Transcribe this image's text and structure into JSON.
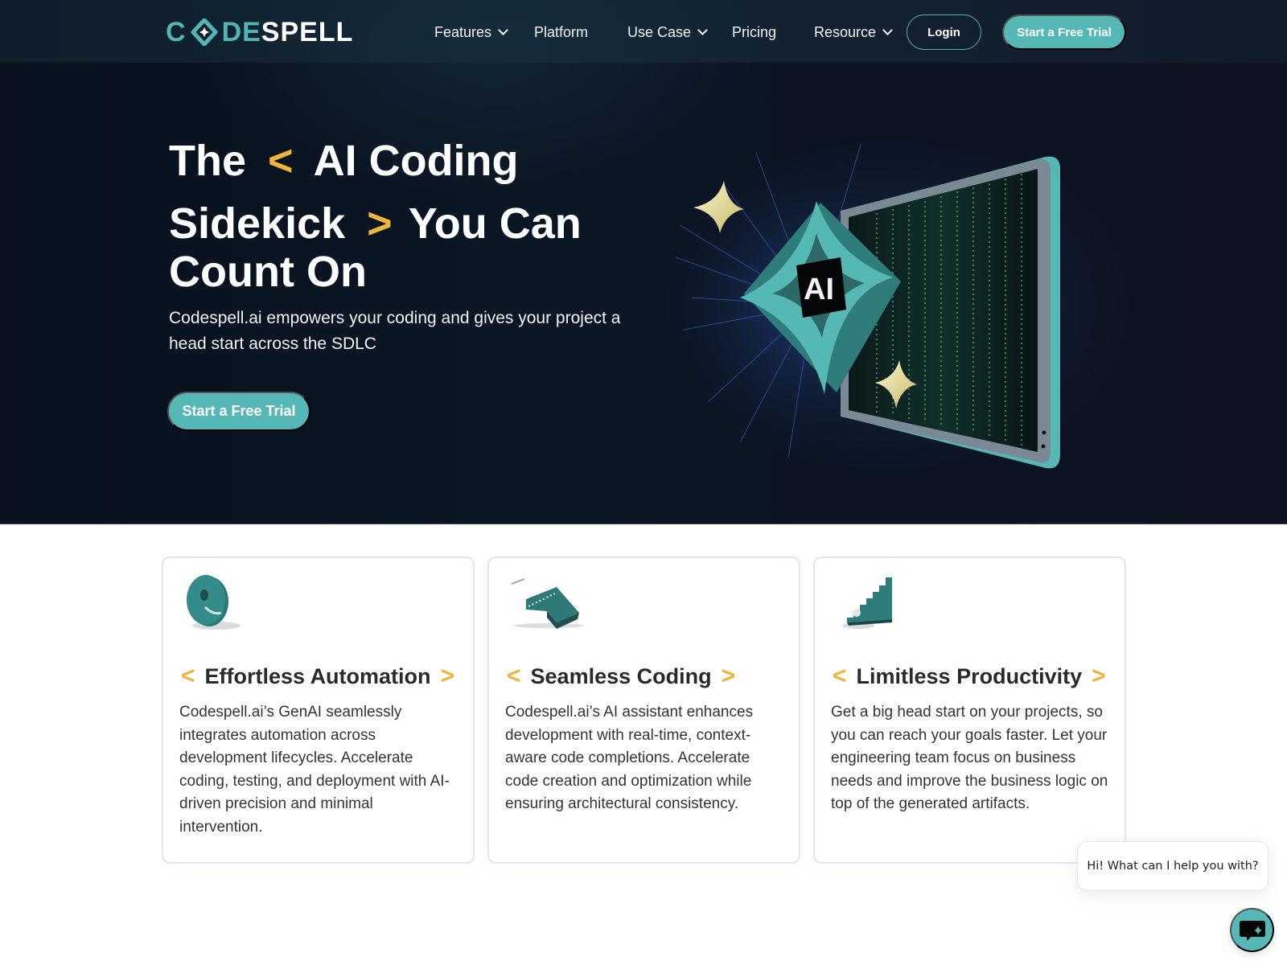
{
  "brand": {
    "logo_code": "C",
    "logo_ode": "DE",
    "logo_spell": "SPELL",
    "logo_full": "CODESPELL",
    "accent_color": "#55b8b6",
    "bracket_color": "#f0b43c"
  },
  "nav": {
    "items": [
      {
        "label": "Features",
        "has_dropdown": true
      },
      {
        "label": "Platform",
        "has_dropdown": false
      },
      {
        "label": "Use Case",
        "has_dropdown": true
      },
      {
        "label": "Pricing",
        "has_dropdown": false
      },
      {
        "label": "Resource",
        "has_dropdown": true
      }
    ],
    "login_label": "Login",
    "trial_label": "Start a Free Trial"
  },
  "hero": {
    "title_line1_a": "The",
    "title_line1_bracket": "<",
    "title_line1_b": "AI Coding",
    "title_line2_a": "Sidekick",
    "title_line2_bracket": ">",
    "title_line2_b": "You Can",
    "title_line3": "Count On",
    "subtitle": "Codespell.ai empowers your coding and gives your project a head start across the SDLC",
    "cta_label": "Start a Free Trial",
    "illustration_label": "AI"
  },
  "features": [
    {
      "icon": "ring-icon",
      "open": "<",
      "title": "Effortless Automation",
      "close": ">",
      "text": "Codespell.ai’s GenAI seamlessly integrates automation across development lifecycles. Accelerate coding, testing, and deployment with AI-driven precision and minimal intervention."
    },
    {
      "icon": "block-icon",
      "open": "<",
      "title": "Seamless Coding",
      "close": ">",
      "text": "Codespell.ai’s AI assistant enhances development with real-time, context-aware code completions. Accelerate code creation and optimization while ensuring architectural consistency."
    },
    {
      "icon": "stairs-icon",
      "open": "<",
      "title": "Limitless Productivity",
      "close": ">",
      "text": "Get a big head start on your projects, so you can reach your goals faster. Let your engineering team focus on business needs and improve the business logic on top of the generated artifacts."
    }
  ],
  "chat": {
    "greeting": "Hi! What can I help you with?",
    "fab_icon": "chat-sparkle-icon"
  }
}
